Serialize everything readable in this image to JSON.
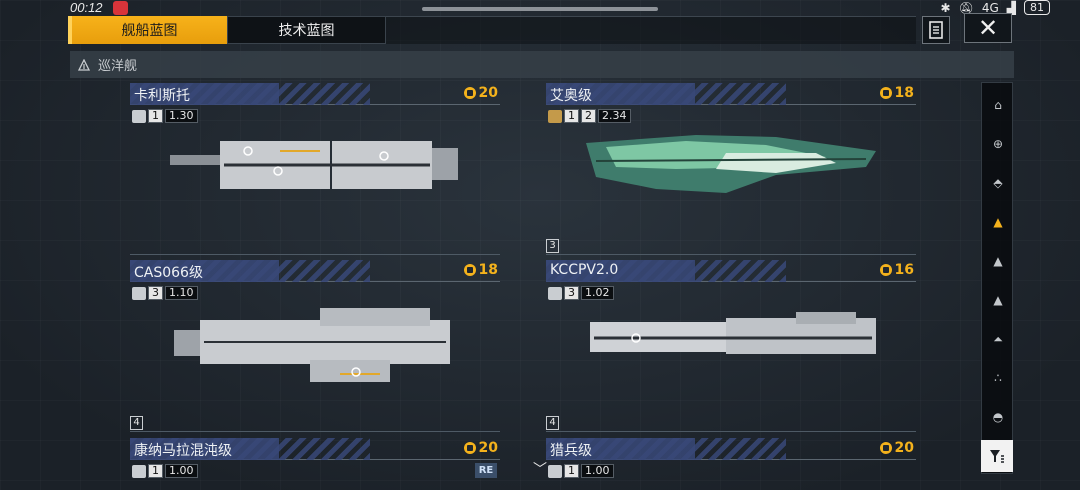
{
  "status_bar": {
    "time": "00:12",
    "network": "4G",
    "battery": "81"
  },
  "tabs": [
    {
      "label": "舰船蓝图",
      "active": true
    },
    {
      "label": "技术蓝图",
      "active": false
    }
  ],
  "section": {
    "title": "巡洋舰"
  },
  "ships": [
    {
      "name": "卡利斯托",
      "cost": "20",
      "level": "1",
      "stat": "1.30",
      "tier": ""
    },
    {
      "name": "艾奥级",
      "cost": "18",
      "level": "1",
      "level2": "2",
      "stat": "2.34",
      "tier": "3"
    },
    {
      "name": "CAS066级",
      "cost": "18",
      "level": "3",
      "stat": "1.10",
      "tier": "4"
    },
    {
      "name": "KCCPV2.0",
      "cost": "16",
      "level": "3",
      "stat": "1.02",
      "tier": "4"
    },
    {
      "name": "康纳马拉混沌级",
      "cost": "20",
      "level": "1",
      "stat": "1.00",
      "tier": ""
    },
    {
      "name": "猎兵级",
      "cost": "20",
      "level": "1",
      "stat": "1.00",
      "tier": ""
    }
  ],
  "badges": {
    "re": "RE"
  },
  "colors": {
    "accent": "#f4b21c",
    "panel": "#1f262e",
    "name_plate": "#38487a"
  },
  "sidebar_icons": [
    "carrier-icon",
    "battleship-icon",
    "battlecruiser-icon",
    "cruiser-icon",
    "destroyer-icon",
    "frigate-icon",
    "corvette-icon",
    "fighter-icon",
    "support-icon"
  ]
}
